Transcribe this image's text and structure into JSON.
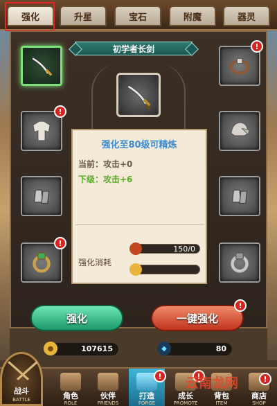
{
  "tabs": [
    {
      "label": "强化",
      "active": true
    },
    {
      "label": "升星",
      "active": false
    },
    {
      "label": "宝石",
      "active": false
    },
    {
      "label": "附魔",
      "active": false
    },
    {
      "label": "器灵",
      "active": false
    }
  ],
  "item_name": "初学者长剑",
  "card": {
    "title": "强化至80级可精炼",
    "current": "当前：攻击+0",
    "next": "下级：攻击+6",
    "cost_label": "强化消耗",
    "cost_value": "150/0"
  },
  "buttons": {
    "enhance": "强化",
    "one_click": "一键强化"
  },
  "currency": {
    "gold": "107615",
    "diamond": "80"
  },
  "badge_text": "!",
  "nav": [
    {
      "cn": "战斗",
      "en": "BATTLE"
    },
    {
      "cn": "角色",
      "en": "ROLE"
    },
    {
      "cn": "伙伴",
      "en": "FRIENDS"
    },
    {
      "cn": "打造",
      "en": "FORGE"
    },
    {
      "cn": "成长",
      "en": "PROMOTE"
    },
    {
      "cn": "背包",
      "en": "ITEM"
    },
    {
      "cn": "商店",
      "en": "SHOP"
    }
  ],
  "watermark": "云南龙网",
  "colors": {
    "title_blue": "#3c8ad0",
    "current_gray": "#6b5a4a",
    "next_green": "#5aaa2a",
    "highlight_red": "#e8262a"
  }
}
